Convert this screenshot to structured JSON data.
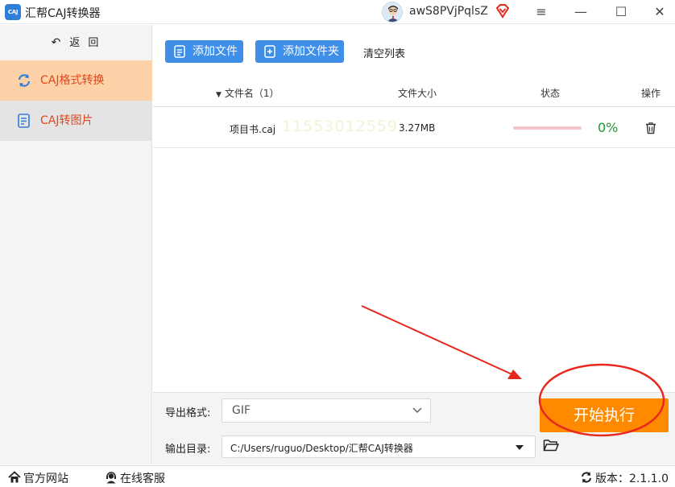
{
  "titlebar": {
    "app_logo_text": "CAJ",
    "app_title": "汇帮CAJ转换器",
    "username": "awS8PVjPqlsZ",
    "menu_glyph": "≡",
    "min_glyph": "—",
    "max_glyph": "☐",
    "close_glyph": "✕"
  },
  "sidebar": {
    "back_label": "返 回",
    "items": [
      {
        "label": "CAJ格式转换",
        "icon": "refresh-icon",
        "active": true
      },
      {
        "label": "CAJ转图片",
        "icon": "document-icon",
        "active": false
      }
    ]
  },
  "toolbar": {
    "add_file_label": "添加文件",
    "add_folder_label": "添加文件夹",
    "clear_label": "清空列表"
  },
  "table": {
    "headers": {
      "name": "文件名（1）",
      "size": "文件大小",
      "status": "状态",
      "op": "操作"
    },
    "rows": [
      {
        "name": "项目书.caj",
        "size": "3.27MB",
        "progress": 0,
        "percent": "0%",
        "watermark": "11553012559"
      }
    ]
  },
  "bottom": {
    "format_label": "导出格式:",
    "format_value": "GIF",
    "dir_label": "输出目录:",
    "dir_value": "C:/Users/ruguo/Desktop/汇帮CAJ转换器",
    "start_label": "开始执行"
  },
  "statusbar": {
    "site_label": "官方网站",
    "service_label": "在线客服",
    "version_label": "版本：2.1.1.0"
  },
  "colors": {
    "accent_blue": "#3f8ee8",
    "active_sidebar": "#fdd2a8",
    "sidebar_text": "#e0471a",
    "start_orange": "#ff8a00",
    "progress_green": "#1d9a2d",
    "annotation_red": "#e8281e"
  }
}
